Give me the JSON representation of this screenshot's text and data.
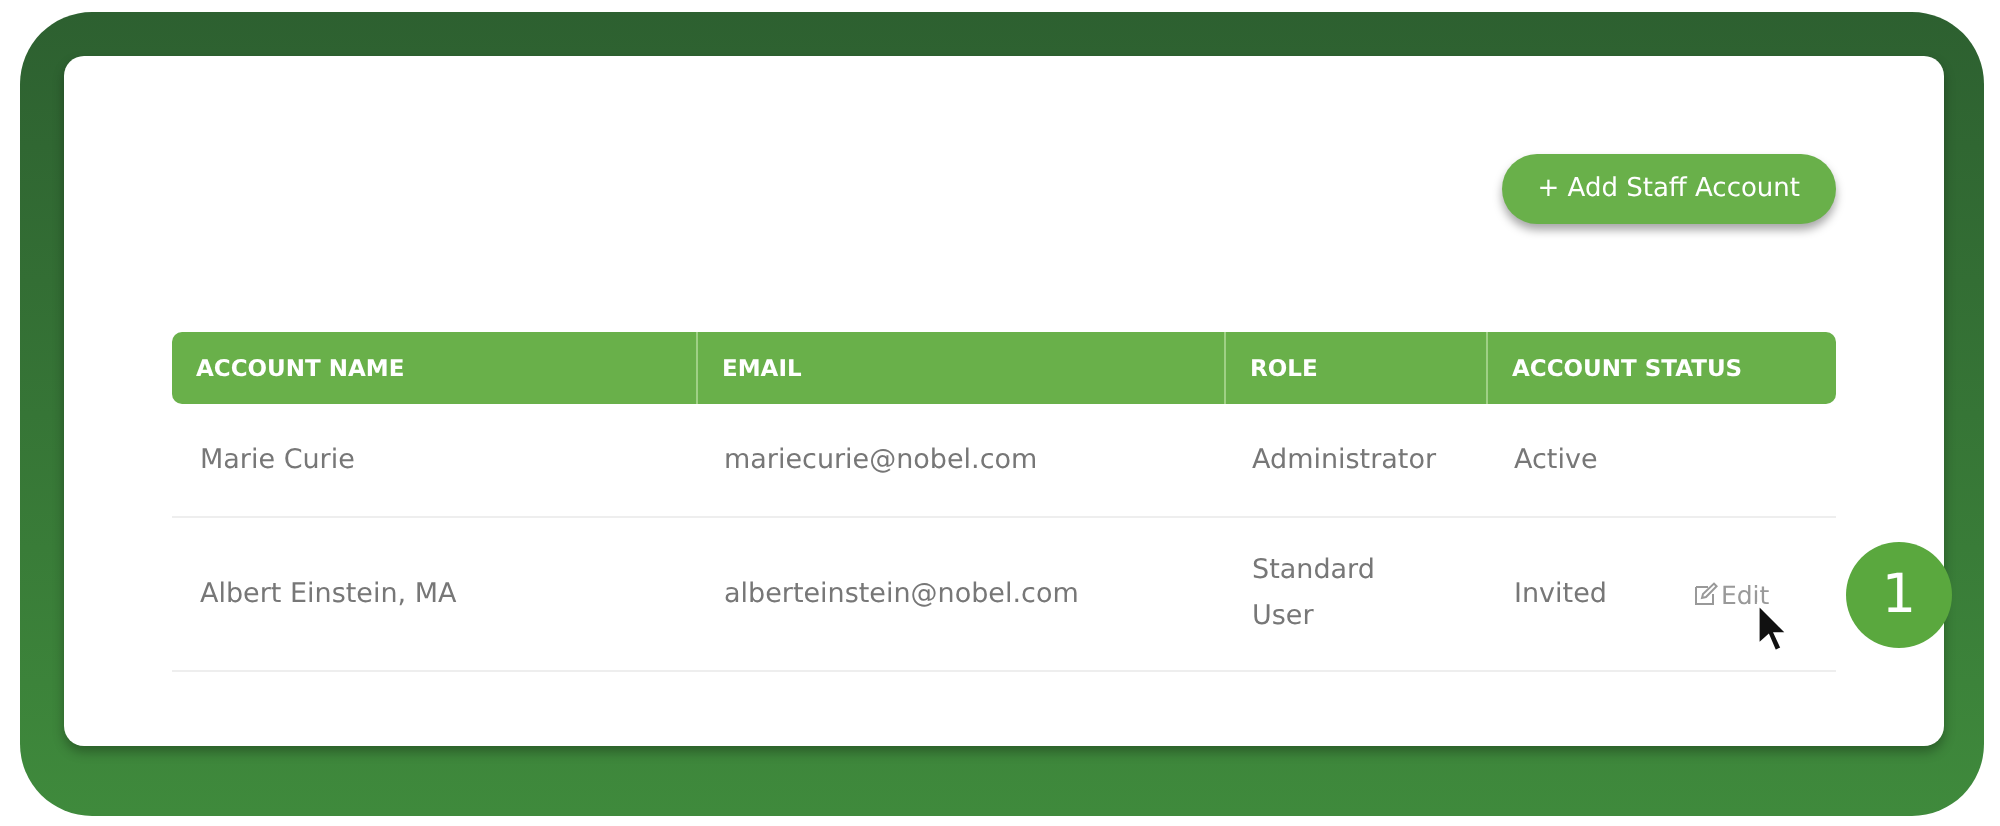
{
  "add_button": {
    "label": "+ Add Staff Account"
  },
  "table": {
    "columns": [
      "ACCOUNT NAME",
      "EMAIL",
      "ROLE",
      "ACCOUNT STATUS"
    ],
    "rows": [
      {
        "name": "Marie Curie",
        "email": "mariecurie@nobel.com",
        "role": "Administrator",
        "status": "Active"
      },
      {
        "name": "Albert Einstein, MA",
        "email": "alberteinstein@nobel.com",
        "role": "Standard User",
        "status": "Invited",
        "action": "Edit"
      }
    ]
  },
  "step_badge": "1"
}
